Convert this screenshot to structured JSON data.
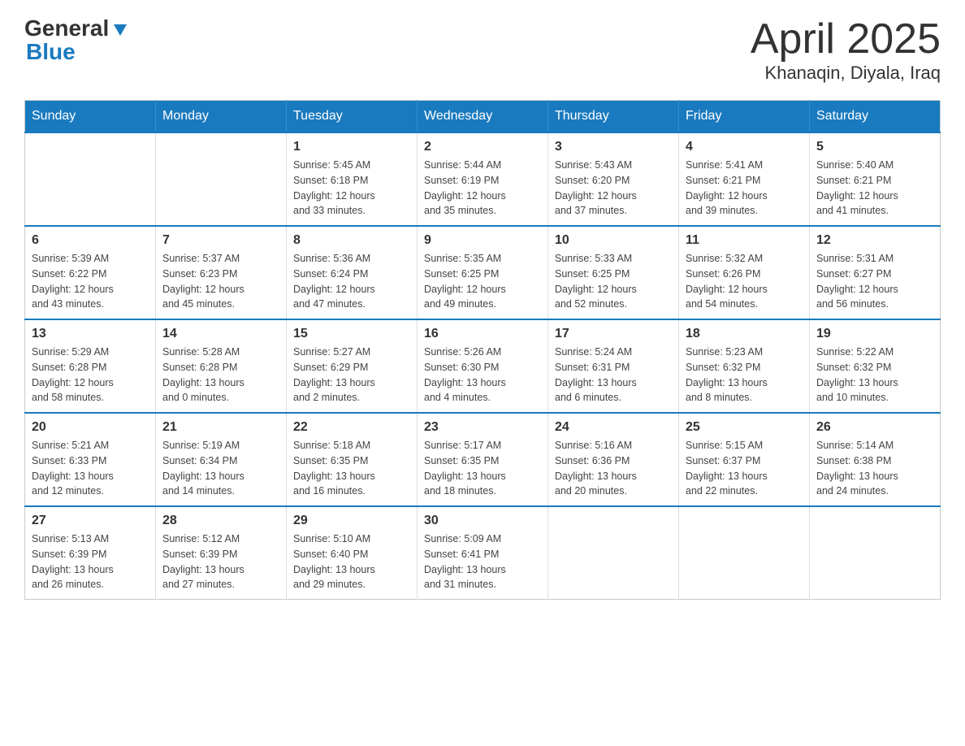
{
  "header": {
    "logo_general": "General",
    "logo_blue": "Blue",
    "month_title": "April 2025",
    "location": "Khanaqin, Diyala, Iraq"
  },
  "days_of_week": [
    "Sunday",
    "Monday",
    "Tuesday",
    "Wednesday",
    "Thursday",
    "Friday",
    "Saturday"
  ],
  "weeks": [
    [
      {
        "day": "",
        "info": ""
      },
      {
        "day": "",
        "info": ""
      },
      {
        "day": "1",
        "info": "Sunrise: 5:45 AM\nSunset: 6:18 PM\nDaylight: 12 hours\nand 33 minutes."
      },
      {
        "day": "2",
        "info": "Sunrise: 5:44 AM\nSunset: 6:19 PM\nDaylight: 12 hours\nand 35 minutes."
      },
      {
        "day": "3",
        "info": "Sunrise: 5:43 AM\nSunset: 6:20 PM\nDaylight: 12 hours\nand 37 minutes."
      },
      {
        "day": "4",
        "info": "Sunrise: 5:41 AM\nSunset: 6:21 PM\nDaylight: 12 hours\nand 39 minutes."
      },
      {
        "day": "5",
        "info": "Sunrise: 5:40 AM\nSunset: 6:21 PM\nDaylight: 12 hours\nand 41 minutes."
      }
    ],
    [
      {
        "day": "6",
        "info": "Sunrise: 5:39 AM\nSunset: 6:22 PM\nDaylight: 12 hours\nand 43 minutes."
      },
      {
        "day": "7",
        "info": "Sunrise: 5:37 AM\nSunset: 6:23 PM\nDaylight: 12 hours\nand 45 minutes."
      },
      {
        "day": "8",
        "info": "Sunrise: 5:36 AM\nSunset: 6:24 PM\nDaylight: 12 hours\nand 47 minutes."
      },
      {
        "day": "9",
        "info": "Sunrise: 5:35 AM\nSunset: 6:25 PM\nDaylight: 12 hours\nand 49 minutes."
      },
      {
        "day": "10",
        "info": "Sunrise: 5:33 AM\nSunset: 6:25 PM\nDaylight: 12 hours\nand 52 minutes."
      },
      {
        "day": "11",
        "info": "Sunrise: 5:32 AM\nSunset: 6:26 PM\nDaylight: 12 hours\nand 54 minutes."
      },
      {
        "day": "12",
        "info": "Sunrise: 5:31 AM\nSunset: 6:27 PM\nDaylight: 12 hours\nand 56 minutes."
      }
    ],
    [
      {
        "day": "13",
        "info": "Sunrise: 5:29 AM\nSunset: 6:28 PM\nDaylight: 12 hours\nand 58 minutes."
      },
      {
        "day": "14",
        "info": "Sunrise: 5:28 AM\nSunset: 6:28 PM\nDaylight: 13 hours\nand 0 minutes."
      },
      {
        "day": "15",
        "info": "Sunrise: 5:27 AM\nSunset: 6:29 PM\nDaylight: 13 hours\nand 2 minutes."
      },
      {
        "day": "16",
        "info": "Sunrise: 5:26 AM\nSunset: 6:30 PM\nDaylight: 13 hours\nand 4 minutes."
      },
      {
        "day": "17",
        "info": "Sunrise: 5:24 AM\nSunset: 6:31 PM\nDaylight: 13 hours\nand 6 minutes."
      },
      {
        "day": "18",
        "info": "Sunrise: 5:23 AM\nSunset: 6:32 PM\nDaylight: 13 hours\nand 8 minutes."
      },
      {
        "day": "19",
        "info": "Sunrise: 5:22 AM\nSunset: 6:32 PM\nDaylight: 13 hours\nand 10 minutes."
      }
    ],
    [
      {
        "day": "20",
        "info": "Sunrise: 5:21 AM\nSunset: 6:33 PM\nDaylight: 13 hours\nand 12 minutes."
      },
      {
        "day": "21",
        "info": "Sunrise: 5:19 AM\nSunset: 6:34 PM\nDaylight: 13 hours\nand 14 minutes."
      },
      {
        "day": "22",
        "info": "Sunrise: 5:18 AM\nSunset: 6:35 PM\nDaylight: 13 hours\nand 16 minutes."
      },
      {
        "day": "23",
        "info": "Sunrise: 5:17 AM\nSunset: 6:35 PM\nDaylight: 13 hours\nand 18 minutes."
      },
      {
        "day": "24",
        "info": "Sunrise: 5:16 AM\nSunset: 6:36 PM\nDaylight: 13 hours\nand 20 minutes."
      },
      {
        "day": "25",
        "info": "Sunrise: 5:15 AM\nSunset: 6:37 PM\nDaylight: 13 hours\nand 22 minutes."
      },
      {
        "day": "26",
        "info": "Sunrise: 5:14 AM\nSunset: 6:38 PM\nDaylight: 13 hours\nand 24 minutes."
      }
    ],
    [
      {
        "day": "27",
        "info": "Sunrise: 5:13 AM\nSunset: 6:39 PM\nDaylight: 13 hours\nand 26 minutes."
      },
      {
        "day": "28",
        "info": "Sunrise: 5:12 AM\nSunset: 6:39 PM\nDaylight: 13 hours\nand 27 minutes."
      },
      {
        "day": "29",
        "info": "Sunrise: 5:10 AM\nSunset: 6:40 PM\nDaylight: 13 hours\nand 29 minutes."
      },
      {
        "day": "30",
        "info": "Sunrise: 5:09 AM\nSunset: 6:41 PM\nDaylight: 13 hours\nand 31 minutes."
      },
      {
        "day": "",
        "info": ""
      },
      {
        "day": "",
        "info": ""
      },
      {
        "day": "",
        "info": ""
      }
    ]
  ]
}
